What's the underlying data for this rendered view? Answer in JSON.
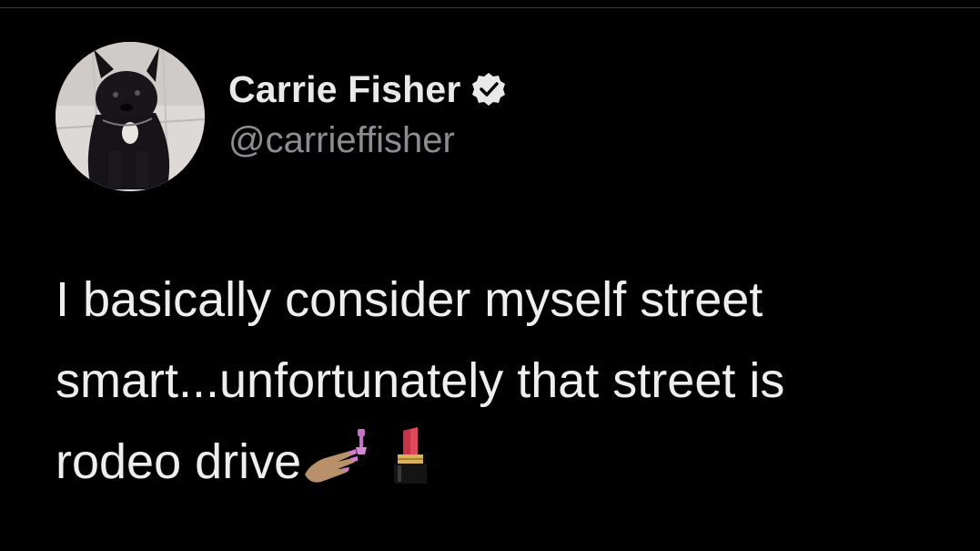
{
  "tweet": {
    "author": {
      "display_name": "Carrie Fisher",
      "handle": "@carrieffisher",
      "verified": true
    },
    "body_lines": [
      "I basically consider myself street",
      "smart...unfortunately that street is",
      "rodeo drive"
    ],
    "emojis": [
      "nail-polish-emoji",
      "lipstick-emoji"
    ]
  },
  "colors": {
    "background": "#000000",
    "name": "#e9e9e9",
    "handle": "#8a8d91",
    "text": "#eeeeee"
  }
}
